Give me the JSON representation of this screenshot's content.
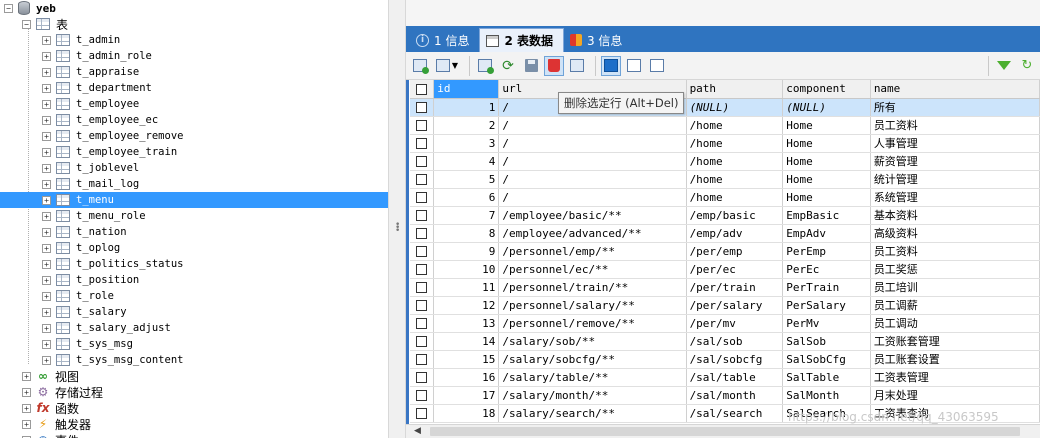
{
  "tree": {
    "root_label": "yeb",
    "tables_group_label": "表",
    "tables": [
      "t_admin",
      "t_admin_role",
      "t_appraise",
      "t_department",
      "t_employee",
      "t_employee_ec",
      "t_employee_remove",
      "t_employee_train",
      "t_joblevel",
      "t_mail_log",
      "t_menu",
      "t_menu_role",
      "t_nation",
      "t_oplog",
      "t_politics_status",
      "t_position",
      "t_role",
      "t_salary",
      "t_salary_adjust",
      "t_sys_msg",
      "t_sys_msg_content"
    ],
    "selected_table": "t_menu",
    "other_groups": [
      {
        "label": "视图",
        "icon": "view-icon"
      },
      {
        "label": "存储过程",
        "icon": "gear-icon"
      },
      {
        "label": "函数",
        "icon": "function-icon"
      },
      {
        "label": "触发器",
        "icon": "lightning-icon"
      },
      {
        "label": "事件",
        "icon": "clock-icon"
      }
    ]
  },
  "tabs": [
    {
      "label": "1 信息",
      "icon": "info-icon",
      "active": false
    },
    {
      "label": "2 表数据",
      "icon": "table-data-icon",
      "active": true
    },
    {
      "label": "3 信息",
      "icon": "info-colored-icon",
      "active": false
    }
  ],
  "tooltip": "删除选定行 (Alt+Del)",
  "grid": {
    "columns": [
      "id",
      "url",
      "path",
      "component",
      "name"
    ],
    "rows": [
      {
        "id": "1",
        "url": "/",
        "path": "(NULL)",
        "component": "(NULL)",
        "name": "所有"
      },
      {
        "id": "2",
        "url": "/",
        "path": "/home",
        "component": "Home",
        "name": "员工资料"
      },
      {
        "id": "3",
        "url": "/",
        "path": "/home",
        "component": "Home",
        "name": "人事管理"
      },
      {
        "id": "4",
        "url": "/",
        "path": "/home",
        "component": "Home",
        "name": "薪资管理"
      },
      {
        "id": "5",
        "url": "/",
        "path": "/home",
        "component": "Home",
        "name": "统计管理"
      },
      {
        "id": "6",
        "url": "/",
        "path": "/home",
        "component": "Home",
        "name": "系统管理"
      },
      {
        "id": "7",
        "url": "/employee/basic/**",
        "path": "/emp/basic",
        "component": "EmpBasic",
        "name": "基本资料"
      },
      {
        "id": "8",
        "url": "/employee/advanced/**",
        "path": "/emp/adv",
        "component": "EmpAdv",
        "name": "高级资料"
      },
      {
        "id": "9",
        "url": "/personnel/emp/**",
        "path": "/per/emp",
        "component": "PerEmp",
        "name": "员工资料"
      },
      {
        "id": "10",
        "url": "/personnel/ec/**",
        "path": "/per/ec",
        "component": "PerEc",
        "name": "员工奖惩"
      },
      {
        "id": "11",
        "url": "/personnel/train/**",
        "path": "/per/train",
        "component": "PerTrain",
        "name": "员工培训"
      },
      {
        "id": "12",
        "url": "/personnel/salary/**",
        "path": "/per/salary",
        "component": "PerSalary",
        "name": "员工调薪"
      },
      {
        "id": "13",
        "url": "/personnel/remove/**",
        "path": "/per/mv",
        "component": "PerMv",
        "name": "员工调动"
      },
      {
        "id": "14",
        "url": "/salary/sob/**",
        "path": "/sal/sob",
        "component": "SalSob",
        "name": "工资账套管理"
      },
      {
        "id": "15",
        "url": "/salary/sobcfg/**",
        "path": "/sal/sobcfg",
        "component": "SalSobCfg",
        "name": "员工账套设置"
      },
      {
        "id": "16",
        "url": "/salary/table/**",
        "path": "/sal/table",
        "component": "SalTable",
        "name": "工资表管理"
      },
      {
        "id": "17",
        "url": "/salary/month/**",
        "path": "/sal/month",
        "component": "SalMonth",
        "name": "月末处理"
      },
      {
        "id": "18",
        "url": "/salary/search/**",
        "path": "/sal/search",
        "component": "SalSearch",
        "name": "工资表查询"
      }
    ]
  },
  "watermark": "https://blog.csdn.net/qq_43063595",
  "colors": {
    "tab_bar": "#2f74c0",
    "selection": "#3399ff",
    "first_row": "#cce4fb"
  }
}
